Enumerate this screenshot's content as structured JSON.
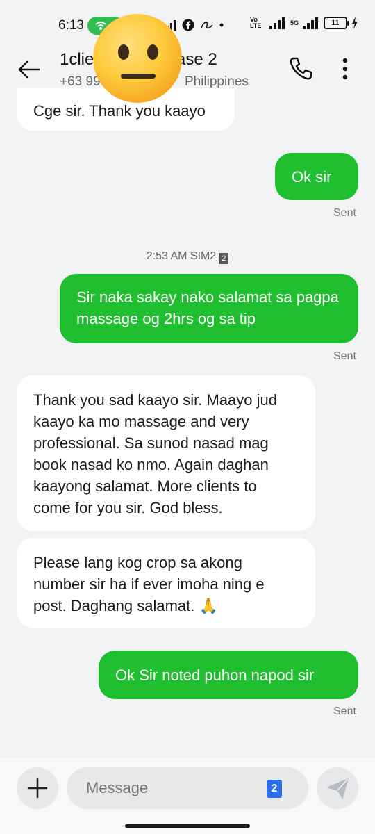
{
  "status_bar": {
    "time": "6:13",
    "volte_label": "Vo LTE",
    "network_label": "5G",
    "battery_level": "11"
  },
  "header": {
    "name_visible_start": "1clie",
    "name_visible_end": "ase 2",
    "number_visible": "+63 99",
    "country": "Philippines"
  },
  "messages": [
    {
      "direction": "incoming",
      "text": "Cge sir. Thank you kaayo"
    },
    {
      "direction": "outgoing",
      "text": "Ok sir",
      "status": "Sent"
    },
    {
      "direction": "timestamp",
      "text": "2:53 AM  SIM2",
      "sim": "2"
    },
    {
      "direction": "outgoing",
      "text": "Sir naka sakay nako salamat sa pagpa massage og 2hrs og sa tip",
      "status": "Sent"
    },
    {
      "direction": "incoming",
      "text": "Thank you sad kaayo sir. Maayo jud kaayo ka mo massage and very professional. Sa sunod nasad mag book nasad ko nmo. Again daghan kaayong salamat. More clients to come for you sir. God bless."
    },
    {
      "direction": "incoming",
      "text": "Please lang kog crop sa akong number sir ha if ever imoha ning e post. Daghang salamat. 🙏"
    },
    {
      "direction": "outgoing",
      "text": "Ok Sir noted puhon napod sir",
      "status": "Sent"
    }
  ],
  "composer": {
    "placeholder": "Message",
    "sim_number": "2"
  },
  "colors": {
    "outgoing_bubble": "#1fbf2f",
    "incoming_bubble": "#ffffff",
    "background": "#f1f3f5",
    "hotspot": "#2ebd4e"
  }
}
